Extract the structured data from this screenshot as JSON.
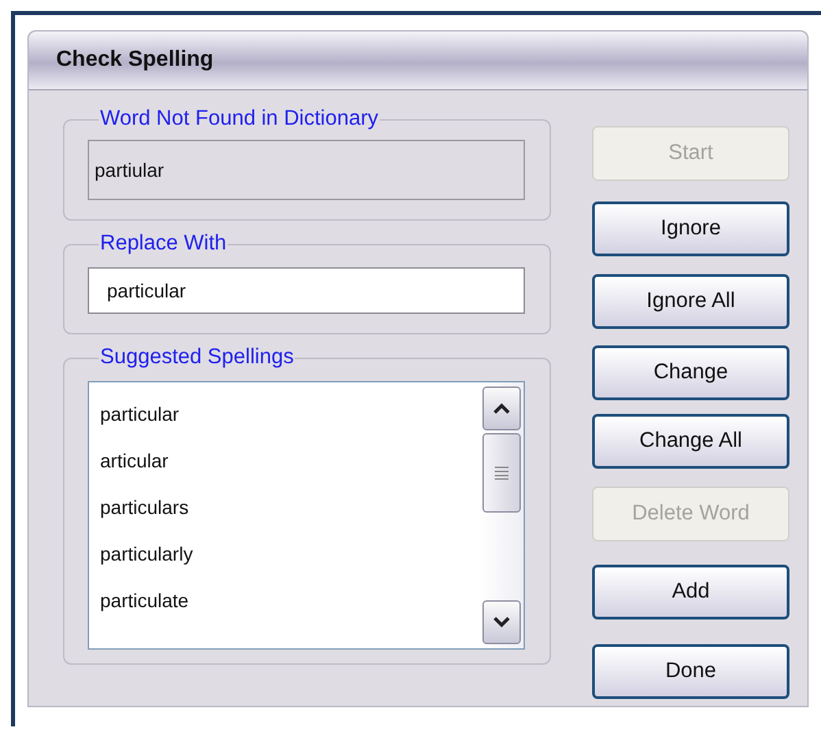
{
  "window": {
    "title": "Check Spelling"
  },
  "word_not_found": {
    "label": "Word Not Found in Dictionary",
    "value": "partiular"
  },
  "replace_with": {
    "label": "Replace With",
    "value": "particular"
  },
  "suggestions": {
    "label": "Suggested Spellings",
    "items": [
      {
        "text": "particular"
      },
      {
        "text": "articular"
      },
      {
        "text": "particulars"
      },
      {
        "text": "particularly"
      },
      {
        "text": "particulate"
      }
    ]
  },
  "buttons": [
    {
      "label": "Start",
      "disabled": true
    },
    {
      "label": "Ignore",
      "disabled": false
    },
    {
      "label": "Ignore All",
      "disabled": false
    },
    {
      "label": "Change",
      "disabled": false
    },
    {
      "label": "Change All",
      "disabled": false
    },
    {
      "label": "Delete Word",
      "disabled": true
    },
    {
      "label": "Add",
      "disabled": false
    },
    {
      "label": "Done",
      "disabled": false
    }
  ]
}
